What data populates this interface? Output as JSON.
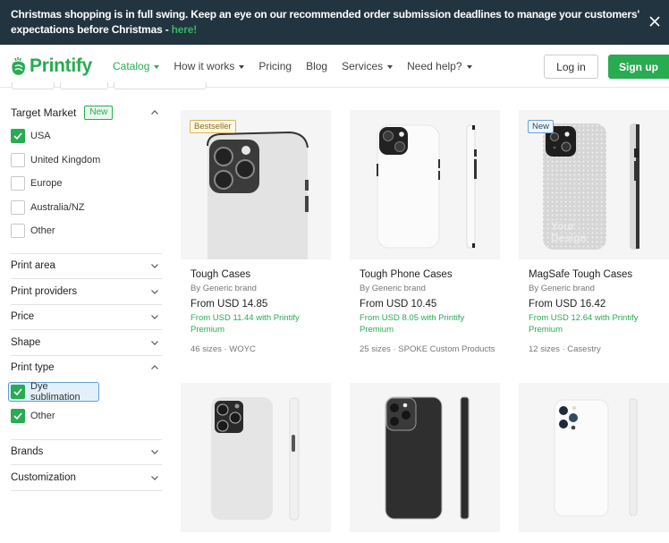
{
  "banner": {
    "text": "Christmas shopping is in full swing. Keep an eye on our recommended order submission deadlines to manage your customers' expectations before Christmas - ",
    "link": "here!",
    "close_icon": "close-icon"
  },
  "nav": {
    "logo": "Printify",
    "links": [
      {
        "label": "Catalog",
        "dropdown": true,
        "active": true
      },
      {
        "label": "How it works",
        "dropdown": true
      },
      {
        "label": "Pricing",
        "dropdown": false
      },
      {
        "label": "Blog",
        "dropdown": false
      },
      {
        "label": "Services",
        "dropdown": true
      },
      {
        "label": "Need help?",
        "dropdown": true
      }
    ],
    "login": "Log in",
    "signup": "Sign up"
  },
  "colors": {
    "brand": "#29ab51",
    "banner_bg": "#21343f"
  },
  "sidebar": {
    "target_market": {
      "title": "Target Market",
      "badge": "New",
      "expanded": true,
      "options": [
        {
          "label": "USA",
          "checked": true
        },
        {
          "label": "United Kingdom",
          "checked": false
        },
        {
          "label": "Europe",
          "checked": false
        },
        {
          "label": "Australia/NZ",
          "checked": false
        },
        {
          "label": "Other",
          "checked": false
        }
      ]
    },
    "collapsed_filters_top": [
      "Print area",
      "Print providers",
      "Price",
      "Shape"
    ],
    "print_type": {
      "title": "Print type",
      "expanded": true,
      "options": [
        {
          "label": "Dye sublimation",
          "checked": true,
          "focused": true
        },
        {
          "label": "Other",
          "checked": true
        }
      ]
    },
    "collapsed_filters_bottom": [
      "Brands",
      "Customization"
    ]
  },
  "products": [
    {
      "title": "Tough Cases",
      "brand": "By Generic brand",
      "price": "From USD 14.85",
      "premium": "From USD 11.44 with Printify Premium",
      "meta": "46 sizes · WOYC",
      "badge": "Bestseller"
    },
    {
      "title": "Tough Phone Cases",
      "brand": "By Generic brand",
      "price": "From USD 10.45",
      "premium": "From USD 8.05 with Printify Premium",
      "meta": "25 sizes · SPOKE Custom Products",
      "badge": ""
    },
    {
      "title": "MagSafe Tough Cases",
      "brand": "By Generic brand",
      "price": "From USD 16.42",
      "premium": "From USD 12.64 with Printify Premium",
      "meta": "12 sizes · Casestry",
      "badge": "New",
      "design_text": "Your Design"
    },
    {
      "title": "",
      "image": "white-slim-case"
    },
    {
      "title": "",
      "image": "black-clear-case"
    },
    {
      "title": "",
      "image": "white-frosted-case"
    }
  ]
}
